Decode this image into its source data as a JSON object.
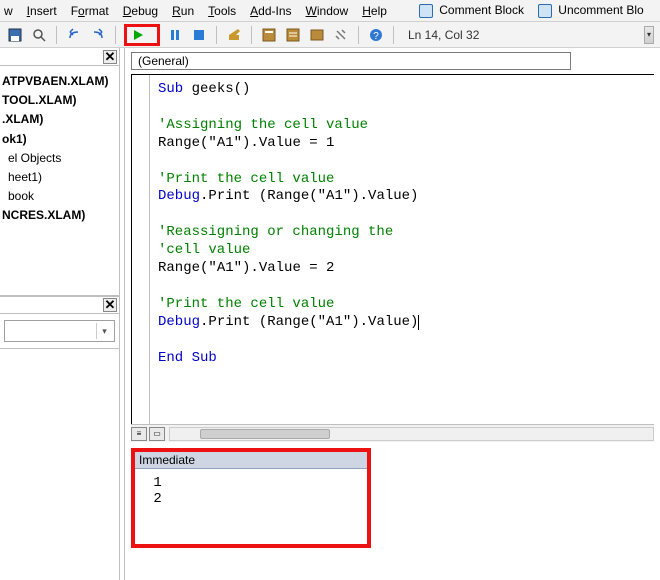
{
  "menu": {
    "view": "w",
    "insert": "Insert",
    "format": "Format",
    "debug": "Debug",
    "run": "Run",
    "tools": "Tools",
    "addins": "Add-Ins",
    "window": "Window",
    "help": "Help",
    "comment": "Comment Block",
    "uncomment": "Uncomment Blo"
  },
  "toolbar": {
    "position": "Ln 14, Col 32"
  },
  "project": {
    "items": [
      "ATPVBAEN.XLAM)",
      "TOOL.XLAM)",
      ".XLAM)",
      "ok1)",
      "el Objects",
      "heet1)",
      "book",
      "",
      "NCRES.XLAM)"
    ]
  },
  "object_box": "(General)",
  "code": {
    "l1a": "Sub",
    "l1b": " geeks()",
    "l2": "",
    "l3": "'Assigning the cell value",
    "l4a": "Range(",
    "l4b": "\"A1\"",
    "l4c": ").Value = 1",
    "l5": "",
    "l6": "'Print the cell value",
    "l7a": "Debug",
    "l7b": ".Print (Range(",
    "l7c": "\"A1\"",
    "l7d": ").Value)",
    "l8": "",
    "l9": "'Reassigning or changing the",
    "l10": "'cell value",
    "l11a": "Range(",
    "l11b": "\"A1\"",
    "l11c": ").Value = 2",
    "l12": "",
    "l13": "'Print the cell value",
    "l14a": "Debug",
    "l14b": ".Print (Range(",
    "l14c": "\"A1\"",
    "l14d": ").Value)",
    "l15": "",
    "l16": "End Sub"
  },
  "immediate": {
    "title": "Immediate",
    "lines": " 1\n 2"
  }
}
